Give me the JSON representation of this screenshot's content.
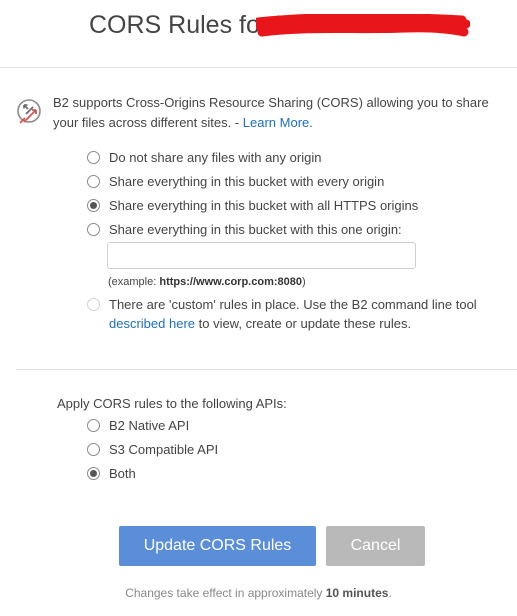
{
  "header": {
    "title": "CORS Rules for ‘"
  },
  "info": {
    "icon": "cors-arrows-icon",
    "text": "B2 supports Cross-Origins Resource Sharing (CORS) allowing you to share your files across different sites. - ",
    "link": "Learn More."
  },
  "share_options": [
    {
      "label": "Do not share any files with any origin",
      "checked": false
    },
    {
      "label": "Share everything in this bucket with every origin",
      "checked": false
    },
    {
      "label": "Share everything in this bucket with all HTTPS origins",
      "checked": true
    },
    {
      "label": "Share everything in this bucket with this one origin:",
      "checked": false
    }
  ],
  "origin_input": {
    "value": "",
    "placeholder": ""
  },
  "example": {
    "prefix": "(example: ",
    "url": "https://www.corp.com:8080",
    "suffix": ")"
  },
  "custom": {
    "text_before": "There are 'custom' rules in place. Use the B2 command line tool ",
    "link": "described here",
    "text_after": " to view, create or update these rules.",
    "disabled": true
  },
  "apis": {
    "label": "Apply CORS rules to the following APIs:",
    "options": [
      {
        "label": "B2 Native API",
        "checked": false
      },
      {
        "label": "S3 Compatible API",
        "checked": false
      },
      {
        "label": "Both",
        "checked": true
      }
    ]
  },
  "buttons": {
    "update": "Update CORS Rules",
    "cancel": "Cancel"
  },
  "footer": {
    "before": "Changes take effect in approximately ",
    "bold": "10 minutes",
    "after": "."
  },
  "colors": {
    "primary": "#5b8ed8",
    "cancel": "#b9b9b9",
    "link": "#1d6fbe",
    "redaction": "#e8161b"
  }
}
